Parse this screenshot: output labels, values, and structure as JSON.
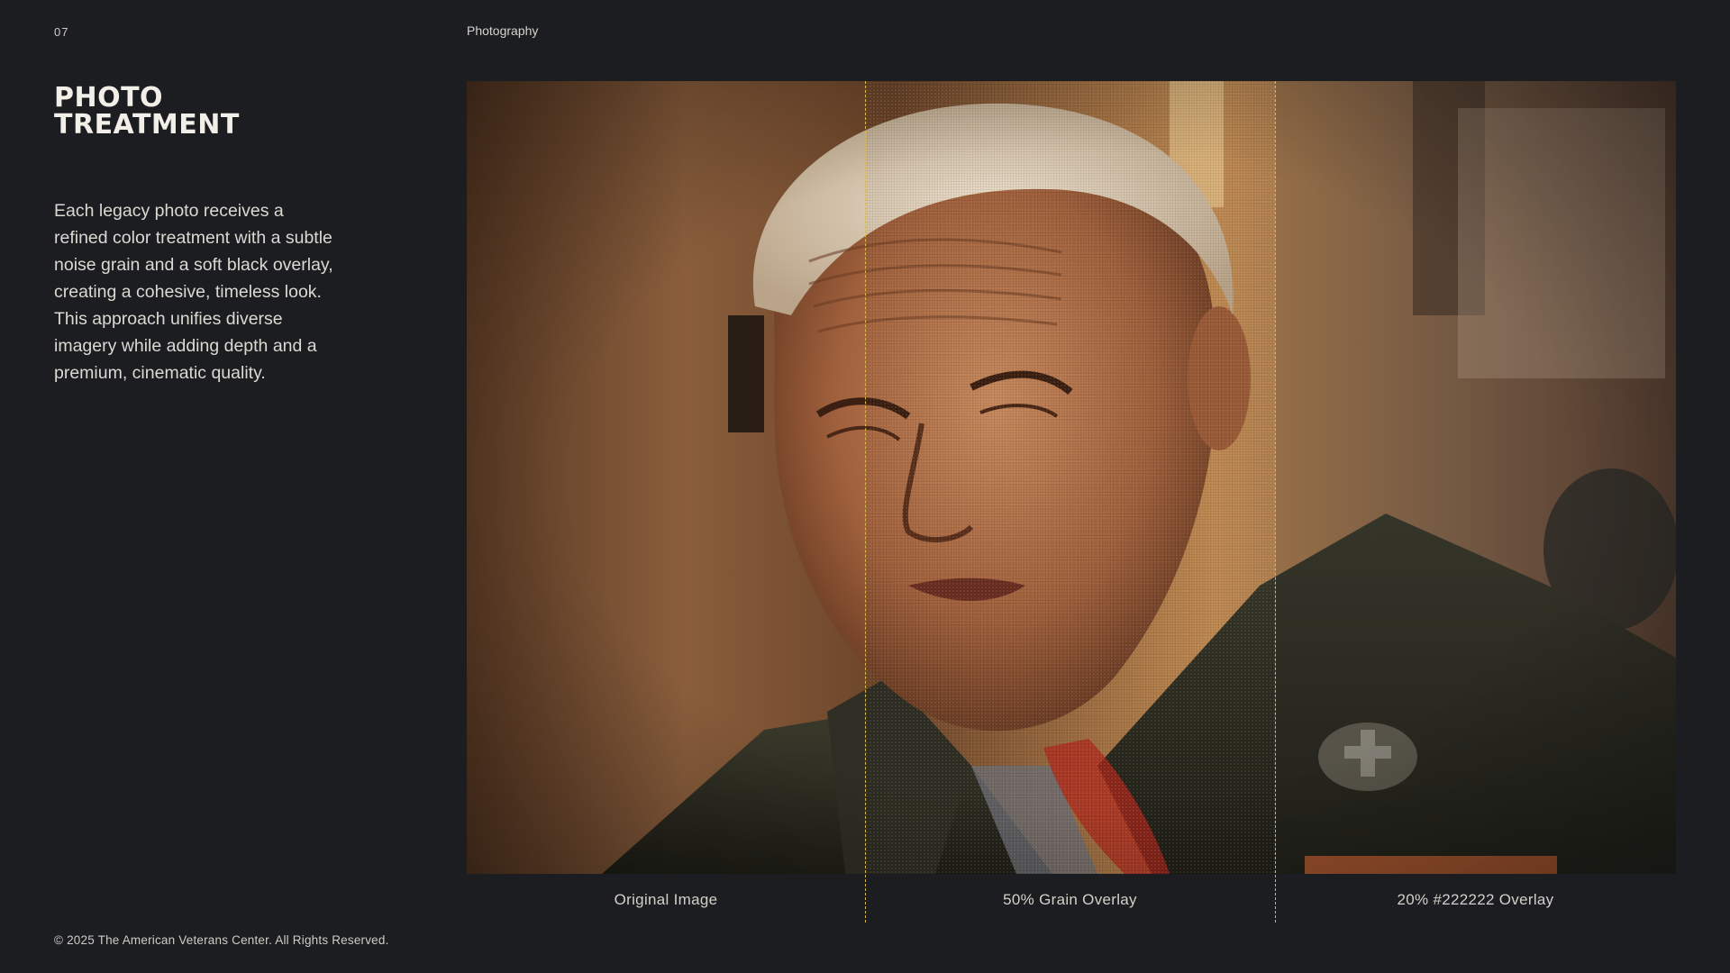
{
  "header": {
    "page_number": "07",
    "section": "Photography"
  },
  "sidebar": {
    "title": "PHOTO\nTREATMENT",
    "description": "Each legacy photo receives a refined color treatment with a subtle noise grain and a soft black overlay, creating a cohesive, timeless look. This approach unifies diverse imagery while adding depth and a premium, cinematic quality."
  },
  "comparison": {
    "panels": [
      {
        "label": "Original Image"
      },
      {
        "label": "50% Grain Overlay"
      },
      {
        "label": "20% #222222 Overlay"
      }
    ],
    "divider_color": "#d9b84a",
    "overlay_color": "#222222",
    "grain_opacity_percent": 50,
    "overlay_opacity_percent": 20
  },
  "footer": {
    "copyright": "© 2025 The American Veterans Center. All Rights Reserved."
  },
  "colors": {
    "background": "#1b1d20",
    "text": "#e6e3dd",
    "accent_divider": "#d9b84a"
  }
}
